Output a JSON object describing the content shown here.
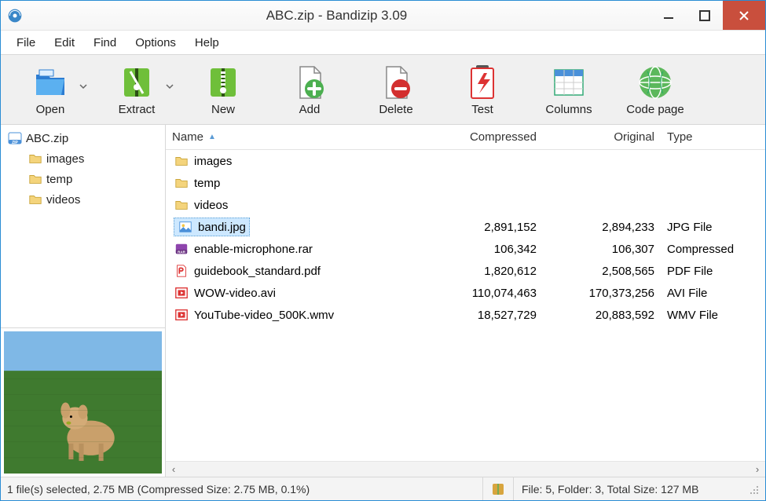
{
  "title": "ABC.zip - Bandizip 3.09",
  "menus": [
    "File",
    "Edit",
    "Find",
    "Options",
    "Help"
  ],
  "toolbar": [
    {
      "id": "open",
      "label": "Open",
      "dropdown": true
    },
    {
      "id": "extract",
      "label": "Extract",
      "dropdown": true
    },
    {
      "id": "new",
      "label": "New",
      "dropdown": false
    },
    {
      "id": "add",
      "label": "Add",
      "dropdown": false
    },
    {
      "id": "delete",
      "label": "Delete",
      "dropdown": false
    },
    {
      "id": "test",
      "label": "Test",
      "dropdown": false
    },
    {
      "id": "columns",
      "label": "Columns",
      "dropdown": false
    },
    {
      "id": "codepage",
      "label": "Code page",
      "dropdown": false
    }
  ],
  "tree": {
    "root": "ABC.zip",
    "children": [
      "images",
      "temp",
      "videos"
    ]
  },
  "columns": {
    "name": "Name",
    "compressed": "Compressed",
    "original": "Original",
    "type": "Type"
  },
  "files": [
    {
      "icon": "folder",
      "name": "images",
      "compressed": "",
      "original": "",
      "type": "",
      "selected": false
    },
    {
      "icon": "folder",
      "name": "temp",
      "compressed": "",
      "original": "",
      "type": "",
      "selected": false
    },
    {
      "icon": "folder",
      "name": "videos",
      "compressed": "",
      "original": "",
      "type": "",
      "selected": false
    },
    {
      "icon": "image",
      "name": "bandi.jpg",
      "compressed": "2,891,152",
      "original": "2,894,233",
      "type": "JPG File",
      "selected": true
    },
    {
      "icon": "rar",
      "name": "enable-microphone.rar",
      "compressed": "106,342",
      "original": "106,307",
      "type": "Compressed",
      "selected": false
    },
    {
      "icon": "pdf",
      "name": "guidebook_standard.pdf",
      "compressed": "1,820,612",
      "original": "2,508,565",
      "type": "PDF File",
      "selected": false
    },
    {
      "icon": "video",
      "name": "WOW-video.avi",
      "compressed": "110,074,463",
      "original": "170,373,256",
      "type": "AVI File",
      "selected": false
    },
    {
      "icon": "video",
      "name": "YouTube-video_500K.wmv",
      "compressed": "18,527,729",
      "original": "20,883,592",
      "type": "WMV File",
      "selected": false
    }
  ],
  "status": {
    "left": "1 file(s) selected, 2.75 MB (Compressed Size: 2.75 MB, 0.1%)",
    "right": "File: 5, Folder: 3, Total Size: 127 MB"
  }
}
